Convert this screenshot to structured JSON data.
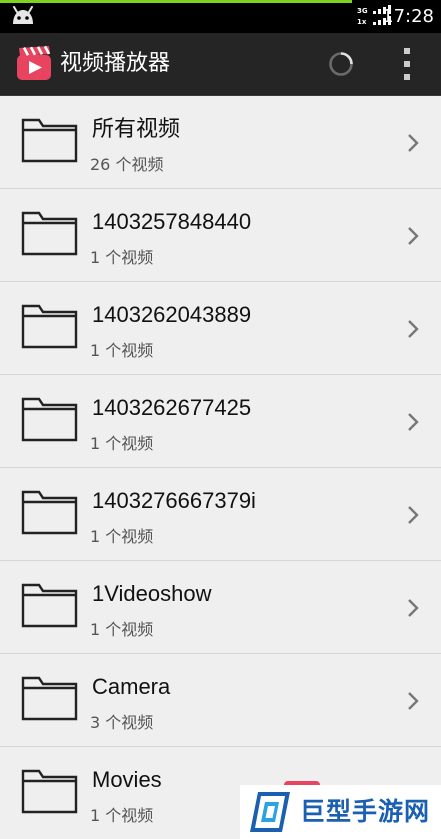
{
  "status_bar": {
    "time": "17:28",
    "network_top": "3G",
    "network_bottom": "1x",
    "progress_color": "#7ed321"
  },
  "action_bar": {
    "title": "视频播放器",
    "logo_icon": "video-clapper-play-icon",
    "loading_icon": "loading-spinner-icon",
    "menu_icon": "overflow-menu-icon"
  },
  "folders": [
    {
      "name": "所有视频",
      "count": "26 个视频"
    },
    {
      "name": "1403257848440",
      "count": "1 个视频"
    },
    {
      "name": "1403262043889",
      "count": "1 个视频"
    },
    {
      "name": "1403262677425",
      "count": "1 个视频"
    },
    {
      "name": "1403276667379i",
      "count": "1 个视频"
    },
    {
      "name": "1Videoshow",
      "count": "1 个视频"
    },
    {
      "name": "Camera",
      "count": "3 个视频"
    },
    {
      "name": "Movies",
      "count": "1 个视频"
    }
  ],
  "watermark": {
    "text": "巨型手游网",
    "color": "#1a5fb0"
  },
  "colors": {
    "action_bar_bg": "#252525",
    "list_bg": "#efefef",
    "logo_red": "#e8435f"
  }
}
